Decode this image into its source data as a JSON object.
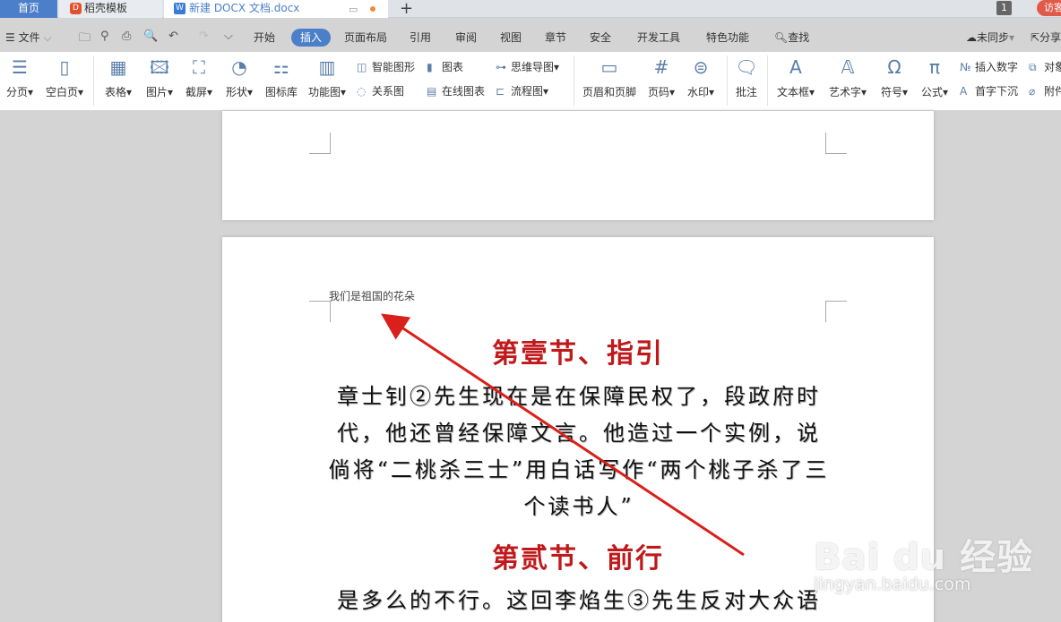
{
  "tabs": {
    "home": "首页",
    "docer": "稻壳模板",
    "doc": "新建 DOCX 文档.docx",
    "badge": "1",
    "visitor": "访客"
  },
  "menu": {
    "file": "文件",
    "items": [
      "开始",
      "插入",
      "页面布局",
      "引用",
      "审阅",
      "视图",
      "章节",
      "安全",
      "开发工具",
      "特色功能"
    ],
    "active": "插入",
    "search": "查找",
    "sync": "未同步",
    "share": "分享"
  },
  "ribbon": {
    "page_break": "分页",
    "blank_page": "空白页",
    "table": "表格",
    "picture": "图片",
    "screenshot": "截屏",
    "shape": "形状",
    "icon_lib": "图标库",
    "func_chart": "功能图",
    "smart_shape": "智能图形",
    "chart": "图表",
    "mindmap": "思维导图",
    "relation": "关系图",
    "online_chart": "在线图表",
    "flowchart": "流程图",
    "header_footer": "页眉和页脚",
    "page_num": "页码",
    "watermark": "水印",
    "comment": "批注",
    "textbox": "文本框",
    "wordart": "艺术字",
    "symbol": "符号",
    "formula": "公式",
    "insert_number": "插入数字",
    "object": "对象",
    "drop_cap": "首字下沉",
    "attachment": "附件"
  },
  "document": {
    "header": "我们是祖国的花朵",
    "heading1": "第壹节、指引",
    "paragraph1": "章士钊②先生现在是在保障民权了，段政府时代，他还曾经保障文言。他造过一个实例，说倘将“二桃杀三士”用白话写作“两个桃子杀了三个读书人”",
    "heading2": "第贰节、前行",
    "paragraph2": "是多么的不行。这回李焰生③先生反对大众语"
  },
  "watermark": {
    "brand": "Bai du 经验",
    "url": "jingyan.baidu.com"
  },
  "colors": {
    "accent": "#4c7fc9",
    "heading": "#c0191b",
    "arrow": "#d9201b"
  }
}
